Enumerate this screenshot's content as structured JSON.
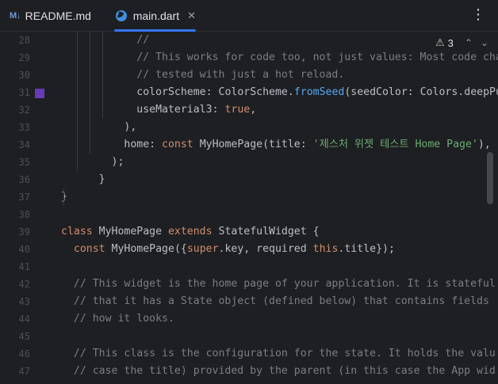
{
  "tabs": [
    {
      "icon": "M↓",
      "label": "README.md",
      "active": false
    },
    {
      "icon": "dart-icon",
      "label": "main.dart",
      "active": true,
      "close": "✕"
    }
  ],
  "more_menu": "⋮",
  "inspections": {
    "warnings": "3",
    "up": "⌃",
    "down": "⌄"
  },
  "colors": {
    "accent": "#3574f0",
    "swatch": "#673ab7"
  },
  "lines": [
    {
      "n": "28",
      "t": [
        [
          "            //",
          "c-com"
        ]
      ]
    },
    {
      "n": "29",
      "t": [
        [
          "            // This works for code too, not just values: Most code change",
          "c-com"
        ]
      ]
    },
    {
      "n": "30",
      "t": [
        [
          "            // tested with just a hot reload.",
          "c-com"
        ]
      ]
    },
    {
      "n": "31",
      "t": [
        [
          "            colorScheme",
          ""
        ],
        [
          ": ",
          ""
        ],
        [
          "ColorScheme",
          ""
        ],
        [
          ".",
          ""
        ],
        [
          "fromSeed",
          ""
        ],
        [
          "(",
          ""
        ],
        [
          "seedColor",
          ""
        ],
        [
          ": ",
          ""
        ],
        [
          "Colors",
          ""
        ],
        [
          ".",
          ""
        ],
        [
          "deepPurp",
          ""
        ]
      ]
    },
    {
      "n": "32",
      "t": [
        [
          "            useMaterial3",
          ""
        ],
        [
          ": ",
          ""
        ],
        [
          "true",
          "c-kw"
        ],
        [
          ",",
          ""
        ]
      ]
    },
    {
      "n": "33",
      "t": [
        [
          "          ),",
          ""
        ]
      ]
    },
    {
      "n": "34",
      "t": [
        [
          "          home",
          ""
        ],
        [
          ": ",
          ""
        ],
        [
          "const ",
          "c-kw"
        ],
        [
          "MyHomePage",
          ""
        ],
        [
          "(",
          ""
        ],
        [
          "title",
          ""
        ],
        [
          ": ",
          ""
        ],
        [
          "'제스처 위젯 테스트 Home Page'",
          "c-str"
        ],
        [
          "),",
          ""
        ]
      ]
    },
    {
      "n": "35",
      "t": [
        [
          "        );",
          ""
        ]
      ]
    },
    {
      "n": "36",
      "t": [
        [
          "      }",
          ""
        ]
      ]
    },
    {
      "n": "37",
      "t": [
        [
          "}",
          ""
        ]
      ]
    },
    {
      "n": "38",
      "t": [
        [
          "",
          ""
        ]
      ]
    },
    {
      "n": "39",
      "t": [
        [
          "class ",
          "c-kw"
        ],
        [
          "MyHomePage ",
          ""
        ],
        [
          "extends ",
          "c-kw"
        ],
        [
          "StatefulWidget {",
          ""
        ]
      ]
    },
    {
      "n": "40",
      "t": [
        [
          "  const ",
          "c-kw"
        ],
        [
          "MyHomePage",
          ""
        ],
        [
          "({",
          ""
        ],
        [
          "super",
          "c-kw"
        ],
        [
          ".key, ",
          ""
        ],
        [
          "required ",
          ""
        ],
        [
          "this",
          "c-kw"
        ],
        [
          ".",
          ""
        ],
        [
          "title",
          ""
        ],
        [
          "});",
          ""
        ]
      ]
    },
    {
      "n": "41",
      "t": [
        [
          "",
          ""
        ]
      ]
    },
    {
      "n": "42",
      "t": [
        [
          "  // This widget is the home page of your application. It is stateful",
          "c-com"
        ]
      ]
    },
    {
      "n": "43",
      "t": [
        [
          "  // that it has a State object (defined below) that contains fields",
          "c-com"
        ]
      ]
    },
    {
      "n": "44",
      "t": [
        [
          "  // how it looks.",
          "c-com"
        ]
      ]
    },
    {
      "n": "45",
      "t": [
        [
          "",
          ""
        ]
      ]
    },
    {
      "n": "46",
      "t": [
        [
          "  // This class is the configuration for the state. It holds the valu",
          "c-com"
        ]
      ]
    },
    {
      "n": "47",
      "t": [
        [
          "  // case the title) provided by the parent (in this case the App wid",
          "c-com"
        ]
      ]
    }
  ]
}
